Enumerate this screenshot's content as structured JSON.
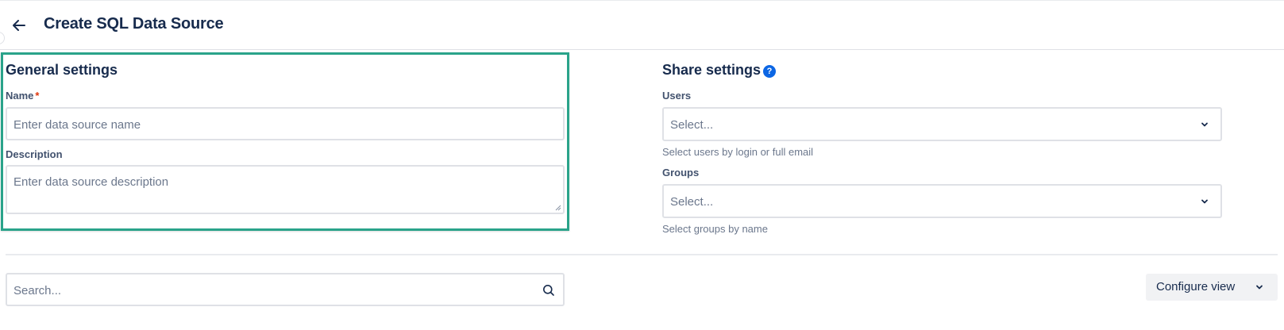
{
  "header": {
    "title": "Create SQL Data Source"
  },
  "general": {
    "title": "General settings",
    "name_label": "Name",
    "required_mark": "*",
    "name_placeholder": "Enter data source name",
    "description_label": "Description",
    "description_placeholder": "Enter data source description"
  },
  "share": {
    "title": "Share settings",
    "help_glyph": "?",
    "users_label": "Users",
    "users_value": "Select...",
    "users_help": "Select users by login or full email",
    "groups_label": "Groups",
    "groups_value": "Select...",
    "groups_help": "Select groups by name"
  },
  "search": {
    "placeholder": "Search..."
  },
  "configure": {
    "label": "Configure view"
  },
  "colors": {
    "accent_border": "#2aa38a",
    "help_icon": "#0c66e4",
    "required": "#de350b"
  }
}
